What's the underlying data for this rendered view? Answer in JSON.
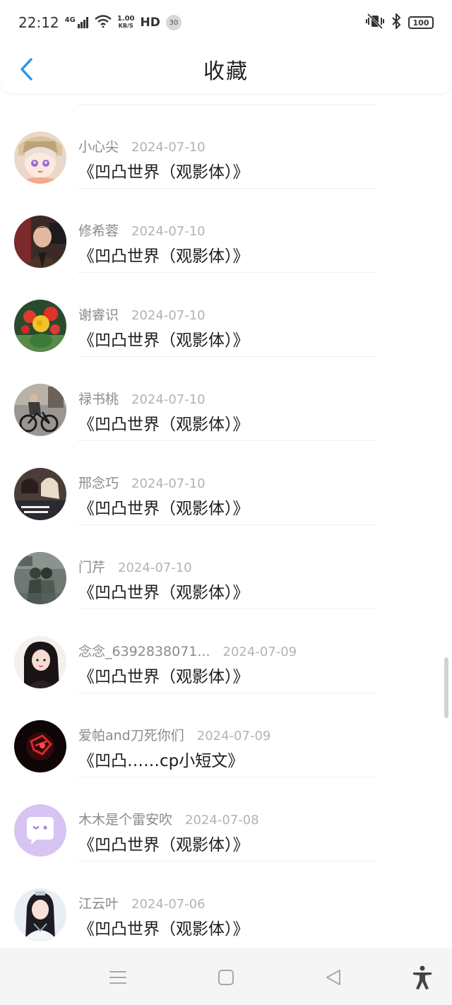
{
  "status_bar": {
    "time": "22:12",
    "network": "4G",
    "speed_value": "1.00",
    "speed_unit": "KB/S",
    "hd": "HD",
    "notification_count": "30",
    "battery": "100"
  },
  "header": {
    "title": "收藏",
    "back_icon": "chevron-left-icon",
    "accent_color": "#2196f3"
  },
  "favorites": [
    {
      "name": "小心尖",
      "date": "2024-07-10",
      "title": "《凹凸世界（观影体）》",
      "avatar": "anime-girl"
    },
    {
      "name": "修希蓉",
      "date": "2024-07-10",
      "title": "《凹凸世界（观影体）》",
      "avatar": "portrait-dark"
    },
    {
      "name": "谢睿识",
      "date": "2024-07-10",
      "title": "《凹凸世界（观影体）》",
      "avatar": "flower"
    },
    {
      "name": "禄书桃",
      "date": "2024-07-10",
      "title": "《凹凸世界（观影体）》",
      "avatar": "bicycle"
    },
    {
      "name": "邢念巧",
      "date": "2024-07-10",
      "title": "《凹凸世界（观影体）》",
      "avatar": "group-photo"
    },
    {
      "name": "门芹",
      "date": "2024-07-10",
      "title": "《凹凸世界（观影体）》",
      "avatar": "street-photo"
    },
    {
      "name": "念念_6392838071...",
      "date": "2024-07-09",
      "title": "《凹凸世界（观影体）》",
      "avatar": "girl-portrait"
    },
    {
      "name": "爱帕and刀死你们",
      "date": "2024-07-09",
      "title": "《凹凸……cp小短文》",
      "avatar": "red-dark"
    },
    {
      "name": "木木是个雷安吹",
      "date": "2024-07-08",
      "title": "《凹凸世界（观影体）》",
      "avatar": "default-chat"
    },
    {
      "name": "江云叶",
      "date": "2024-07-06",
      "title": "《凹凸世界（观影体）》",
      "avatar": "costume-girl"
    }
  ],
  "nav_bar": {
    "icons": [
      "menu-icon",
      "home-square-icon",
      "back-triangle-icon",
      "accessibility-icon"
    ]
  }
}
